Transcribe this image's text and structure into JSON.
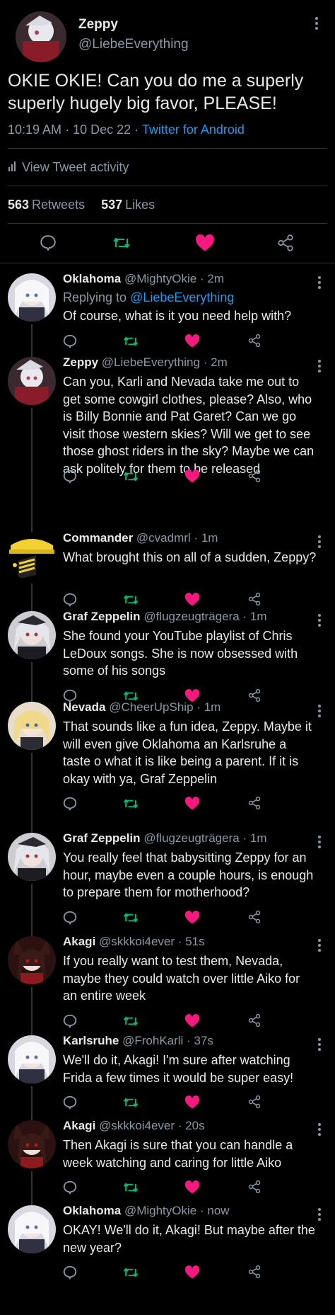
{
  "main_tweet": {
    "name": "Zeppy",
    "handle": "@LiebeEverything",
    "text": "OKIE OKIE! Can you do me a superly superly hugely big favor, PLEASE!",
    "time": "10:19 AM",
    "date": "10 Dec 22",
    "separator": "·",
    "client": "Twitter for Android",
    "activity_label": "View Tweet activity",
    "retweets": "563",
    "retweets_label": "Retweets",
    "likes": "537",
    "likes_label": "Likes"
  },
  "replies": [
    {
      "name": "Oklahoma",
      "handle": "@MightyOkie",
      "time": "2m",
      "replying_label": "Replying to",
      "replying_to": "@LiebeEverything",
      "text": "Of course, what is it you need help with?",
      "avatar": "white-hair-avatar"
    },
    {
      "name": "Zeppy",
      "handle": "@LiebeEverything",
      "time": "2m",
      "text": "Can you, Karli and Nevada take me out to get some cowgirl clothes, please? Also, who is Billy Bonnie and Pat Garet? Can we go visit those western skies? Will we get to see those ghost riders in the sky? Maybe we can ask politely for them to be released",
      "avatar": "zeppy-avatar"
    },
    {
      "name": "Commander",
      "handle": "@cvadmrl",
      "time": "1m",
      "text": "What brought this on all of a sudden, Zeppy?",
      "avatar": "commander-cap-avatar"
    },
    {
      "name": "Graf Zeppelin",
      "handle": "@flugzeugträgera",
      "time": "1m",
      "text": "She found your YouTube playlist of Chris LeDoux songs. She is now obsessed with some of his songs",
      "avatar": "silver-hair-avatar"
    },
    {
      "name": "Nevada",
      "handle": "@CheerUpShip",
      "time": "1m",
      "text": "That sounds like a fun idea, Zeppy. Maybe it will even give Oklahoma an Karlsruhe a taste o what it is like being a parent. If it is okay with ya, Graf Zeppelin",
      "avatar": "blonde-hair-avatar"
    },
    {
      "name": "Graf Zeppelin",
      "handle": "@flugzeugträgera",
      "time": "1m",
      "text": "You really feel that babysitting Zeppy for an hour, maybe even a couple hours, is enough to prepare them for motherhood?",
      "avatar": "silver-hair-avatar"
    },
    {
      "name": "Akagi",
      "handle": "@skkkoi4ever",
      "time": "51s",
      "text": "If you really want to test them, Nevada, maybe they could watch over little Aiko for an entire week",
      "avatar": "fox-ears-avatar"
    },
    {
      "name": "Karlsruhe",
      "handle": "@FrohKarli",
      "time": "37s",
      "text": "We'll do it, Akagi! I'm sure after watching Frida a few times it would be super easy!",
      "avatar": "white-hair-avatar"
    },
    {
      "name": "Akagi",
      "handle": "@skkkoi4ever",
      "time": "20s",
      "text": "Then Akagi is sure that you can handle a week watching and caring for little Aiko",
      "avatar": "fox-ears-avatar"
    },
    {
      "name": "Oklahoma",
      "handle": "@MightyOkie",
      "time": "now",
      "text": "OKAY! We'll do it, Akagi! But maybe after the new year?",
      "avatar": "white-hair-avatar"
    }
  ],
  "icons": {
    "reply": "speech-bubble-icon",
    "retweet": "retweet-icon",
    "like": "heart-icon",
    "share": "share-icon",
    "more": "vertical-dots-icon",
    "activity": "bar-chart-icon"
  },
  "colors": {
    "background": "#000000",
    "text": "#e7e9ea",
    "muted": "#8b98a5",
    "link": "#1d9bf0",
    "retweet": "#00ba7c",
    "like": "#f91880"
  }
}
